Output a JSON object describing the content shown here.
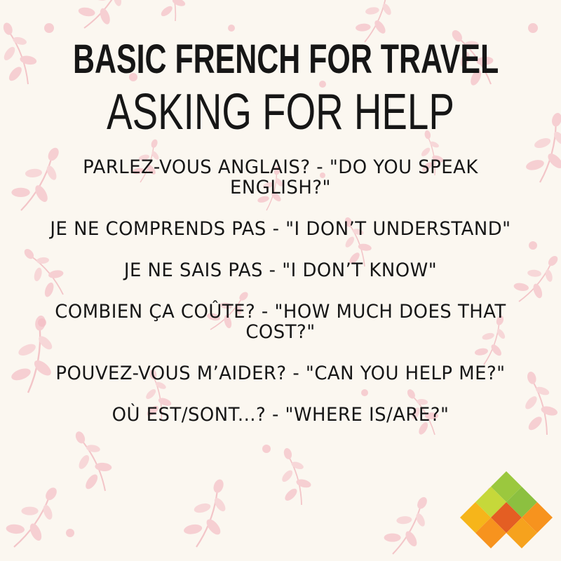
{
  "header": {
    "title": "BASIC FRENCH FOR TRAVEL",
    "subtitle": "ASKING FOR HELP"
  },
  "phrases": [
    "PARLEZ-VOUS ANGLAIS? - \"DO YOU SPEAK ENGLISH?\"",
    "JE NE COMPRENDS PAS - \"I DON’T UNDERSTAND\"",
    "JE NE SAIS PAS - \"I DON’T KNOW\"",
    "COMBIEN ÇA COÛTE? - \"HOW MUCH DOES THAT COST?\"",
    "POUVEZ-VOUS M’AIDER? - \"CAN YOU HELP ME?\"",
    "OÙ EST/SONT...? - \"WHERE IS/ARE?\""
  ],
  "colors": {
    "background": "#fbf7f0",
    "leaf": "#f2b6bd",
    "text": "#161616",
    "logo_green": "#9bc83e",
    "logo_orange": "#f7931e",
    "logo_yellow": "#f6b51a"
  },
  "logo": {
    "icon": "colored-diamond-tiles-logo"
  }
}
